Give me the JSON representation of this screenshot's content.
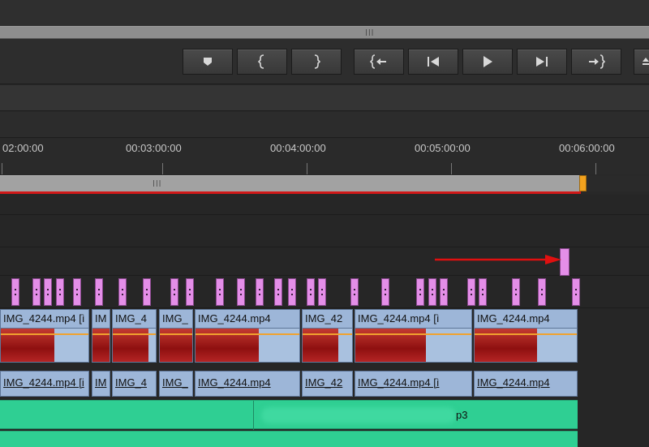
{
  "timeline": {
    "timecodes": [
      "02:00:00",
      "00:03:00:00",
      "00:04:00:00",
      "00:05:00:00",
      "00:06:00:00"
    ]
  },
  "transport": {
    "buttons": [
      "add-marker",
      "mark-in",
      "mark-out",
      "go-to-in",
      "step-back",
      "play",
      "step-forward",
      "go-to-out",
      "extra"
    ]
  },
  "video_clips": [
    {
      "label": "IMG_4244.mp4 [ì"
    },
    {
      "label": "IM"
    },
    {
      "label": "IMG_4"
    },
    {
      "label": "IMG_"
    },
    {
      "label": "IMG_4244.mp4"
    },
    {
      "label": "IMG_42"
    },
    {
      "label": "IMG_4244.mp4 [ì"
    },
    {
      "label": "IMG_4244.mp4"
    }
  ],
  "audio_clips": [
    {
      "label": "IMG_4244.mp4 [i"
    },
    {
      "label": "IM"
    },
    {
      "label": "IMG_4"
    },
    {
      "label": "IMG_"
    },
    {
      "label": "IMG_4244.mp4"
    },
    {
      "label": "IMG_42"
    },
    {
      "label": "IMG_4244.mp4 [ì"
    },
    {
      "label": "IMG_4244.mp4"
    }
  ],
  "music_track": {
    "label": "p3"
  },
  "colors": {
    "marker": "#e48ee8",
    "clip": "#9db6d8",
    "music": "#2fcf93",
    "playhead_line": "#d01818",
    "work_end": "#f2a21e",
    "annotation_arrow": "#e01010"
  }
}
